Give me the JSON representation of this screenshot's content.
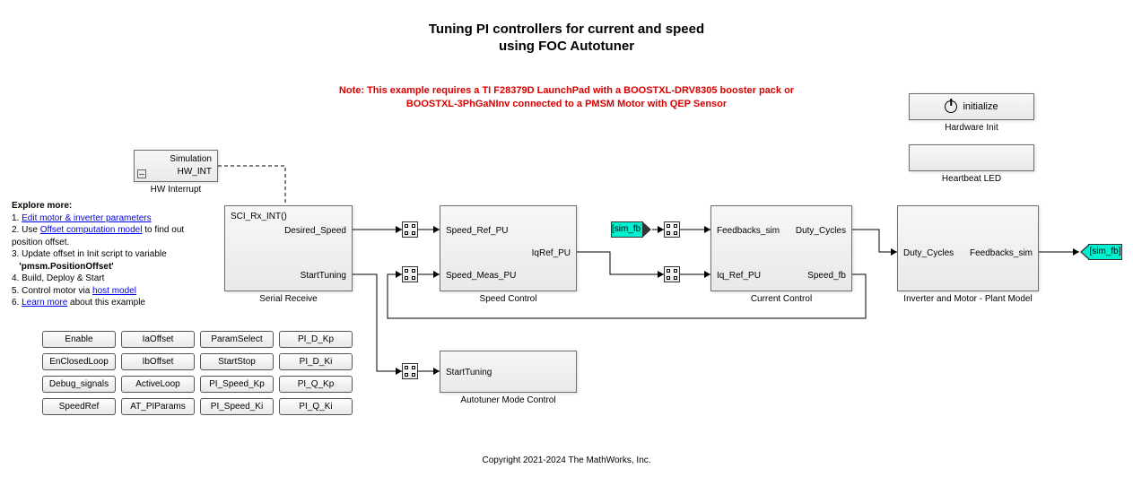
{
  "title_line1": "Tuning PI controllers for current and speed",
  "title_line2": "using FOC Autotuner",
  "note_line1": "Note: This example requires a TI F28379D LaunchPad with a BOOSTXL-DRV8305 booster pack or",
  "note_line2": "BOOSTXL-3PhGaNInv connected to a PMSM Motor with QEP Sensor",
  "explore": {
    "header": "Explore more:",
    "item1_idx": "1. ",
    "item1_link": "Edit motor & inverter parameters",
    "item2_idx": "2. Use ",
    "item2_link": "Offset computation model",
    "item2_tail": " to find out position offset.",
    "item3": "3. Update offset in Init script to variable",
    "item3b": "   'pmsm.PositionOffset'",
    "item4": "4. Build, Deploy & Start",
    "item5_idx": "5. Control motor via ",
    "item5_link": "host model",
    "item6_idx": "6. ",
    "item6_link": "Learn more",
    "item6_tail": " about this example"
  },
  "blocks": {
    "hwint": {
      "line1": "Simulation",
      "line2": "HW_INT",
      "caption": "HW Interrupt"
    },
    "serial": {
      "fn": "SCI_Rx_INT()",
      "out1": "Desired_Speed",
      "out2": "StartTuning",
      "caption": "Serial Receive"
    },
    "speed": {
      "in1": "Speed_Ref_PU",
      "in2": "Speed_Meas_PU",
      "out1": "IqRef_PU",
      "caption": "Speed Control"
    },
    "autotune": {
      "in1": "StartTuning",
      "caption": "Autotuner Mode Control"
    },
    "current": {
      "in1": "Feedbacks_sim",
      "in2": "Iq_Ref_PU",
      "out1": "Duty_Cycles",
      "out2": "Speed_fb",
      "caption": "Current Control"
    },
    "inverter": {
      "in1": "Duty_Cycles",
      "out1": "Feedbacks_sim",
      "caption": "Inverter and Motor - Plant Model"
    },
    "init": {
      "label": "initialize",
      "caption": "Hardware Init"
    },
    "heartbeat": {
      "caption": "Heartbeat LED"
    }
  },
  "tags": {
    "sim_fb_from": "[sim_fb]",
    "sim_fb_goto": "[sim_fb]"
  },
  "buttons": {
    "c1": [
      "Enable",
      "EnClosedLoop",
      "Debug_signals",
      "SpeedRef"
    ],
    "c2": [
      "IaOffset",
      "IbOffset",
      "ActiveLoop",
      "AT_PIParams"
    ],
    "c3": [
      "ParamSelect",
      "StartStop",
      "PI_Speed_Kp",
      "PI_Speed_Ki"
    ],
    "c4": [
      "PI_D_Kp",
      "PI_D_Ki",
      "PI_Q_Kp",
      "PI_Q_Ki"
    ]
  },
  "footer": "Copyright 2021-2024 The MathWorks, Inc."
}
